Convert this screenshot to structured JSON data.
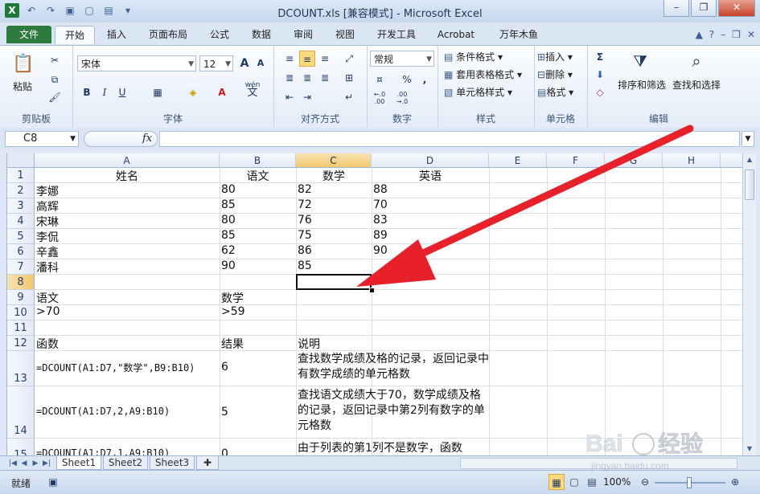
{
  "title": "DCOUNT.xls  [兼容模式] - Microsoft Excel",
  "tabs": [
    "文件",
    "开始",
    "插入",
    "页面布局",
    "公式",
    "数据",
    "审阅",
    "视图",
    "开发工具",
    "Acrobat",
    "万年木鱼"
  ],
  "ribbon": {
    "clipboard": {
      "paste": "粘贴",
      "label": "剪贴板"
    },
    "font": {
      "name": "宋体",
      "size": "12",
      "label": "字体",
      "bold": "B",
      "italic": "I",
      "underline": "U",
      "grow": "A",
      "shrink": "A",
      "wen": "wén",
      "wen2": "文"
    },
    "alignment": {
      "label": "对齐方式"
    },
    "number": {
      "format": "常规",
      "label": "数字",
      "percent": "%",
      "comma": ",",
      "inc": ".0\n.00",
      "dec": ".00\n.0"
    },
    "styles": {
      "conditional": "条件格式",
      "table": "套用表格格式",
      "cell": "单元格样式",
      "label": "样式"
    },
    "cells": {
      "insert": "插入",
      "delete": "删除",
      "format": "格式",
      "label": "单元格"
    },
    "editing": {
      "sort": "排序和筛选",
      "find": "查找和选择",
      "label": "编辑"
    }
  },
  "formula_bar": {
    "name_box": "C8",
    "fx": "fx",
    "formula": ""
  },
  "columns": [
    "A",
    "B",
    "C",
    "D",
    "E",
    "F",
    "G",
    "H"
  ],
  "rows": [
    "1",
    "2",
    "3",
    "4",
    "5",
    "6",
    "7",
    "8",
    "9",
    "10",
    "11",
    "12",
    "13",
    "14",
    "15"
  ],
  "cells": {
    "A1": "姓名",
    "B1": "语文",
    "C1": "数学",
    "D1": "英语",
    "A2": "李娜",
    "B2": "80",
    "C2": "82",
    "D2": "88",
    "A3": "高辉",
    "B3": "85",
    "C3": "72",
    "D3": "70",
    "A4": "宋琳",
    "B4": "80",
    "C4": "76",
    "D4": "83",
    "A5": "李侃",
    "B5": "85",
    "C5": "75",
    "D5": "89",
    "A6": "辛鑫",
    "B6": "62",
    "C6": "86",
    "D6": "90",
    "A7": "潘科",
    "B7": "90",
    "C7": "85",
    "A9": "语文",
    "B9": "数学",
    "A10": ">70",
    "B10": ">59",
    "A12": "函数",
    "B12": "结果",
    "C12": "说明",
    "A13": "=DCOUNT(A1:D7,\"数学\",B9:B10)",
    "B13": "6",
    "C13": "查找数学成绩及格的记录，返回记录中有数学成绩的单元格数",
    "A14": "=DCOUNT(A1:D7,2,A9:B10)",
    "B14": "5",
    "C14": "查找语文成绩大于70，数学成绩及格的记录，返回记录中第2列有数字的单元格数",
    "A15": "=DCOUNT(A1:D7,1,A9:B10)",
    "B15": "0",
    "C15": "由于列表的第1列不是数字，函数"
  },
  "sheets": [
    "Sheet1",
    "Sheet2",
    "Sheet3"
  ],
  "status": {
    "ready": "就绪",
    "zoom": "100%"
  },
  "watermark": "Bai 经验 jingyan.baidu.com",
  "colors": {
    "accent": "#2d7b3d",
    "arrow": "#e8202a",
    "selection": "#f2c86e"
  }
}
